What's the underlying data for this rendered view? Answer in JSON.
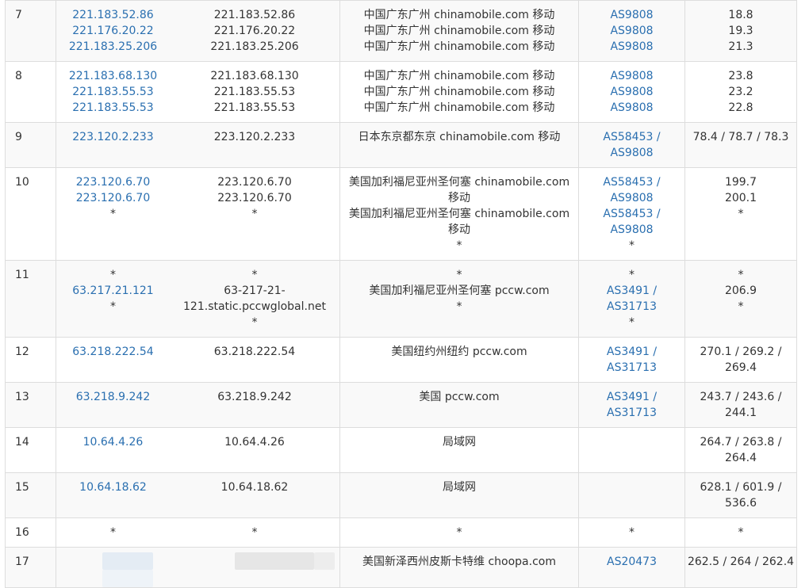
{
  "rows": [
    {
      "hop": "7",
      "ips": [
        "221.183.52.86",
        "221.176.20.22",
        "221.183.25.206"
      ],
      "hosts": [
        "221.183.52.86",
        "221.176.20.22",
        "221.183.25.206"
      ],
      "geo": [
        "中国广东广州 chinamobile.com 移动",
        "中国广东广州 chinamobile.com 移动",
        "中国广东广州 chinamobile.com 移动"
      ],
      "asn": [
        "AS9808",
        "AS9808",
        "AS9808"
      ],
      "rtt": [
        "18.8",
        "19.3",
        "21.3"
      ]
    },
    {
      "hop": "8",
      "ips": [
        "221.183.68.130",
        "221.183.55.53",
        "221.183.55.53"
      ],
      "hosts": [
        "221.183.68.130",
        "221.183.55.53",
        "221.183.55.53"
      ],
      "geo": [
        "中国广东广州 chinamobile.com 移动",
        "中国广东广州 chinamobile.com 移动",
        "中国广东广州 chinamobile.com 移动"
      ],
      "asn": [
        "AS9808",
        "AS9808",
        "AS9808"
      ],
      "rtt": [
        "23.8",
        "23.2",
        "22.8"
      ]
    },
    {
      "hop": "9",
      "ips": [
        "223.120.2.233"
      ],
      "hosts": [
        "223.120.2.233"
      ],
      "geo": [
        "日本东京都东京 chinamobile.com 移动"
      ],
      "asn": [
        "AS58453 /",
        "AS9808"
      ],
      "rtt": [
        "78.4 / 78.7 / 78.3"
      ]
    },
    {
      "hop": "10",
      "ips": [
        "223.120.6.70",
        "223.120.6.70",
        "*"
      ],
      "hosts": [
        "223.120.6.70",
        "223.120.6.70",
        "*"
      ],
      "geo": [
        "美国加利福尼亚州圣何塞 chinamobile.com",
        "移动",
        "美国加利福尼亚州圣何塞 chinamobile.com",
        "移动",
        "*"
      ],
      "asn": [
        "AS58453 /",
        "AS9808",
        "AS58453 /",
        "AS9808",
        "*"
      ],
      "rtt": [
        "199.7",
        "200.1",
        "*"
      ]
    },
    {
      "hop": "11",
      "ips": [
        "*",
        "63.217.21.121",
        "*"
      ],
      "hosts": [
        "*",
        "63-217-21-",
        "121.static.pccwglobal.net",
        "*"
      ],
      "geo": [
        "*",
        "美国加利福尼亚州圣何塞 pccw.com",
        "*"
      ],
      "asn": [
        "*",
        "AS3491 /",
        "AS31713",
        "*"
      ],
      "rtt": [
        "*",
        "206.9",
        "*"
      ]
    },
    {
      "hop": "12",
      "ips": [
        "63.218.222.54"
      ],
      "hosts": [
        "63.218.222.54"
      ],
      "geo": [
        "美国纽约州纽约 pccw.com"
      ],
      "asn": [
        "AS3491 /",
        "AS31713"
      ],
      "rtt": [
        "270.1 / 269.2 /",
        "269.4"
      ]
    },
    {
      "hop": "13",
      "ips": [
        "63.218.9.242"
      ],
      "hosts": [
        "63.218.9.242"
      ],
      "geo": [
        "美国 pccw.com"
      ],
      "asn": [
        "AS3491 /",
        "AS31713"
      ],
      "rtt": [
        "243.7 / 243.6 /",
        "244.1"
      ]
    },
    {
      "hop": "14",
      "ips": [
        "10.64.4.26"
      ],
      "hosts": [
        "10.64.4.26"
      ],
      "geo": [
        "局域网"
      ],
      "asn": [],
      "rtt": [
        "264.7 / 263.8 /",
        "264.4"
      ]
    },
    {
      "hop": "15",
      "ips": [
        "10.64.18.62"
      ],
      "hosts": [
        "10.64.18.62"
      ],
      "geo": [
        "局域网"
      ],
      "asn": [],
      "rtt": [
        "628.1 / 601.9 /",
        "536.6"
      ]
    },
    {
      "hop": "16",
      "ips": [
        "*"
      ],
      "hosts": [
        "*"
      ],
      "geo": [
        "*"
      ],
      "asn": [
        "*"
      ],
      "rtt": [
        "*"
      ]
    },
    {
      "hop": "17",
      "ips": [],
      "hosts": [],
      "geo": [
        "美国新泽西州皮斯卡特维 choopa.com"
      ],
      "asn": [
        "AS20473"
      ],
      "rtt": [
        "262.5 / 264 / 262.4"
      ]
    }
  ],
  "colors": {
    "link": "#2a6fb0",
    "border": "#dddddd",
    "stripe": "#f9f9f9",
    "text": "#333333"
  }
}
